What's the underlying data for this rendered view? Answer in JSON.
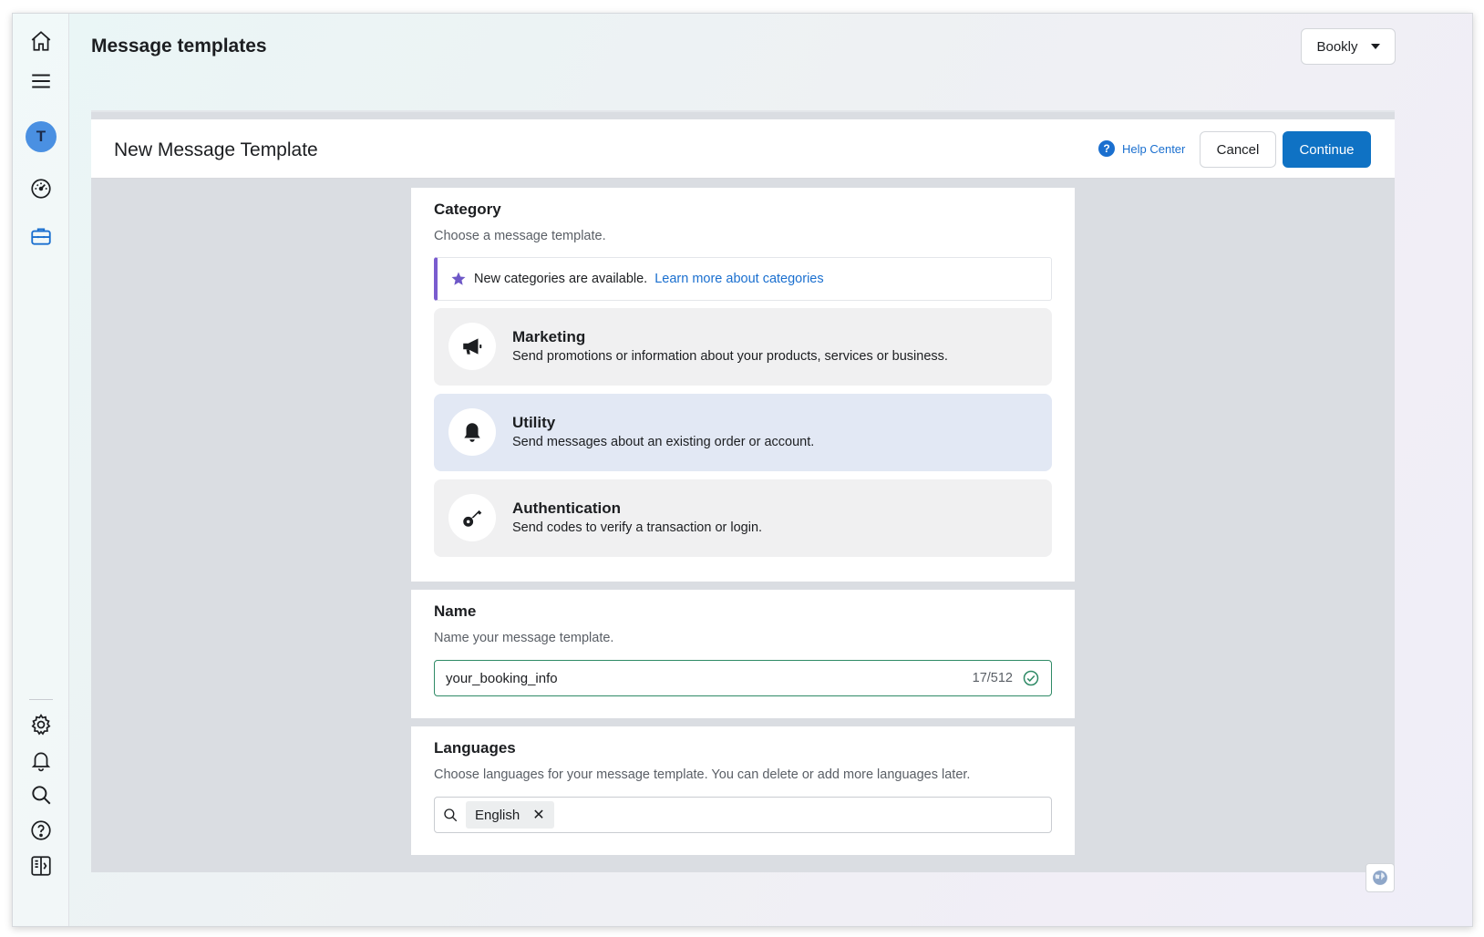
{
  "header": {
    "page_title": "Message templates",
    "account_name": "Bookly"
  },
  "sidebar": {
    "avatar_initial": "T",
    "top_icons": [
      "home-icon",
      "menu-icon",
      "dashboard-icon",
      "briefcase-icon"
    ],
    "bottom_icons": [
      "gear-icon",
      "bell-icon",
      "search-icon",
      "help-icon",
      "panel-toggle-icon"
    ],
    "active_color": "#1a6fcf"
  },
  "panel": {
    "title": "New Message Template",
    "help_label": "Help Center",
    "cancel_label": "Cancel",
    "continue_label": "Continue"
  },
  "category": {
    "title": "Category",
    "subtitle": "Choose a message template.",
    "notice_text": "New categories are available.",
    "notice_link": "Learn more about categories",
    "options": [
      {
        "title": "Marketing",
        "description": "Send promotions or information about your products, services or business.",
        "icon": "megaphone-icon"
      },
      {
        "title": "Utility",
        "description": "Send messages about an existing order or account.",
        "icon": "bell-icon",
        "selected": true
      },
      {
        "title": "Authentication",
        "description": "Send codes to verify a transaction or login.",
        "icon": "key-icon"
      }
    ]
  },
  "name": {
    "title": "Name",
    "subtitle": "Name your message template.",
    "value": "your_booking_info",
    "count": "17/512"
  },
  "languages": {
    "title": "Languages",
    "subtitle": "Choose languages for your message template. You can delete or add more languages later.",
    "selected": [
      "English"
    ]
  },
  "colors": {
    "primary": "#0f72c4",
    "valid": "#2f8a66",
    "notice_accent": "#7a5ccf",
    "selected_option": "#e2e8f4"
  }
}
